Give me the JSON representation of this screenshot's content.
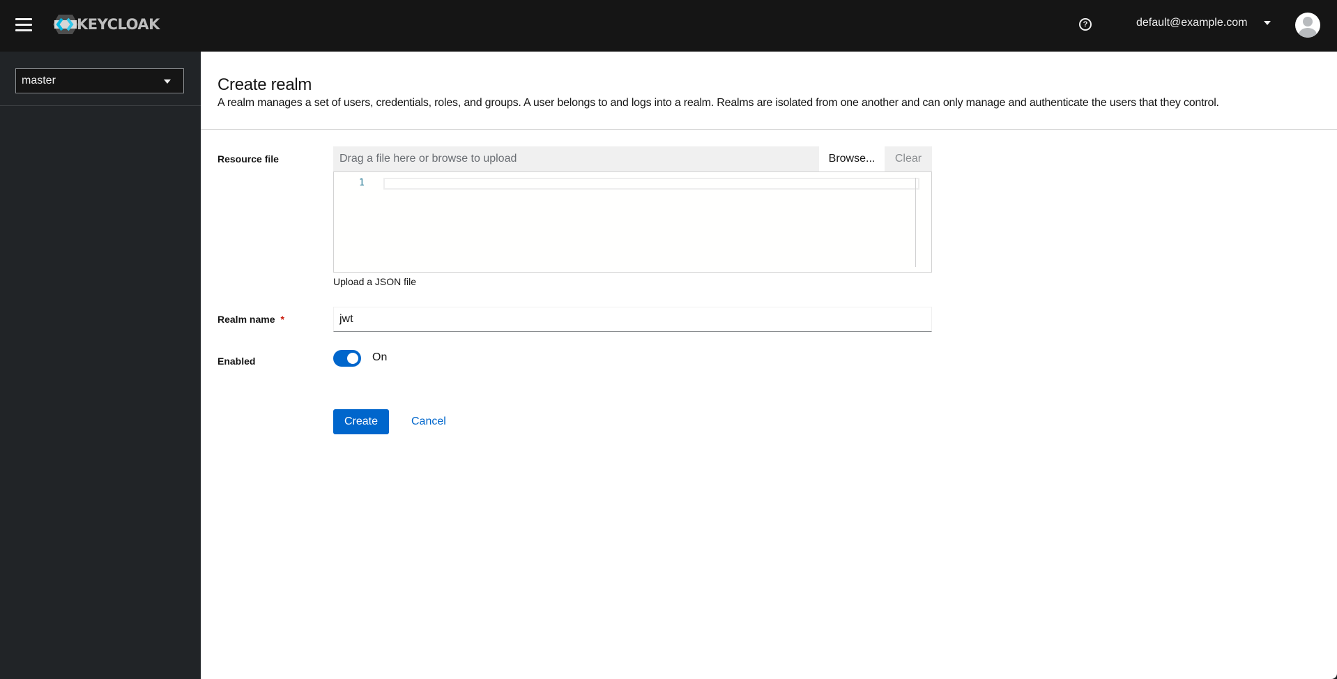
{
  "header": {
    "brand": "KEYCLOAK",
    "user_label": "default@example.com",
    "icons": {
      "menu": "hamburger-icon",
      "help": "help-circle-icon",
      "user_caret": "caret-down-icon",
      "avatar": "user-avatar-icon"
    }
  },
  "sidebar": {
    "realm_selector": {
      "value": "master"
    }
  },
  "page": {
    "title": "Create realm",
    "description": "A realm manages a set of users, credentials, roles, and groups. A user belongs to and logs into a realm. Realms are isolated from one another and can only manage and authenticate the users that they control."
  },
  "form": {
    "resource_file": {
      "label": "Resource file",
      "placeholder": "Drag a file here or browse to upload",
      "browse_label": "Browse...",
      "clear_label": "Clear",
      "editor_line_number": "1",
      "helper_text": "Upload a JSON file"
    },
    "realm_name": {
      "label": "Realm name",
      "required_marker": "*",
      "value": "jwt"
    },
    "enabled": {
      "label": "Enabled",
      "state": true,
      "state_label": "On"
    },
    "actions": {
      "create_label": "Create",
      "cancel_label": "Cancel"
    }
  },
  "colors": {
    "primary": "#0066cc",
    "masthead_bg": "#151515",
    "sidebar_bg": "#212427",
    "required": "#c9190b"
  }
}
